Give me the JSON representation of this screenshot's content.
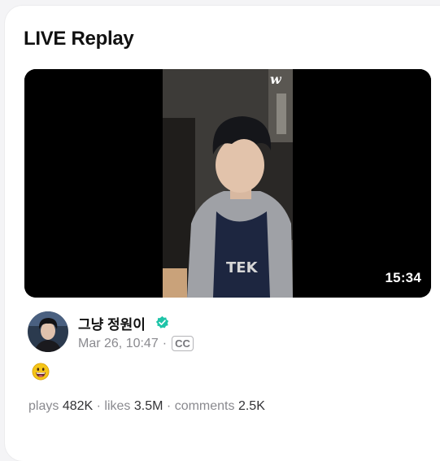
{
  "section": {
    "title": "LIVE Replay"
  },
  "video": {
    "duration": "15:34",
    "watermark": "w"
  },
  "channel": {
    "name": "그냥 정원이",
    "verified": true,
    "date": "Mar 26, 10:47",
    "separator": "·",
    "cc_label": "CC",
    "avatar": "avatar-photo"
  },
  "post": {
    "emoji": "grinning-face-icon"
  },
  "stats": {
    "plays_label": "plays",
    "plays_value": "482K",
    "likes_label": "likes",
    "likes_value": "3.5M",
    "comments_label": "comments",
    "comments_value": "2.5K",
    "separator": "·"
  },
  "colors": {
    "verified": "#1ec4a8",
    "emoji": "#f5c518",
    "text_primary": "#111111",
    "text_secondary": "#8a8a8f"
  }
}
